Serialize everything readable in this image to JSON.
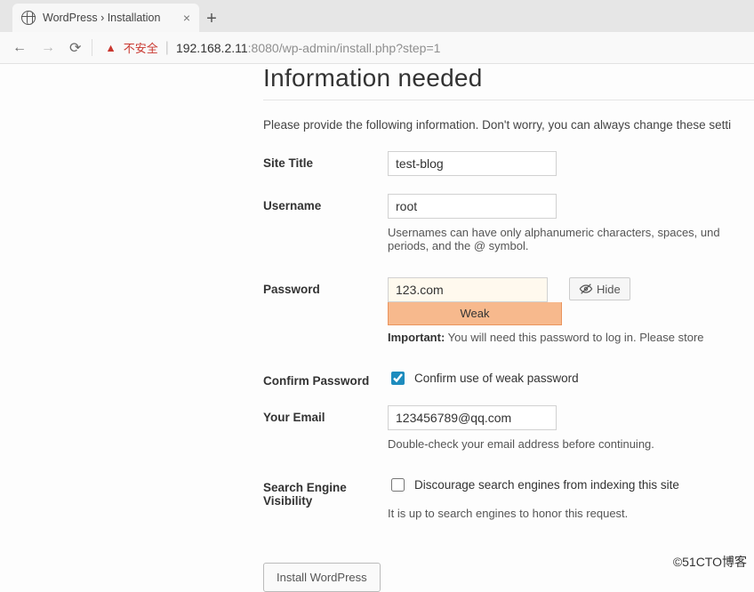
{
  "browser": {
    "tab_title": "WordPress › Installation",
    "not_secure_label": "不安全",
    "url_host": "192.168.2.11",
    "url_port_path": ":8080/wp-admin/install.php?step=1"
  },
  "page": {
    "heading": "Information needed",
    "intro": "Please provide the following information. Don't worry, you can always change these setti"
  },
  "form": {
    "site_title_label": "Site Title",
    "site_title_value": "test-blog",
    "username_label": "Username",
    "username_value": "root",
    "username_hint": "Usernames can have only alphanumeric characters, spaces, und\nperiods, and the @ symbol.",
    "password_label": "Password",
    "password_value": "123.com",
    "hide_button_label": "Hide",
    "password_strength": "Weak",
    "password_important_label": "Important:",
    "password_important_text": " You will need this password to log in. Please store",
    "confirm_password_label": "Confirm Password",
    "confirm_checkbox_label": "Confirm use of weak password",
    "email_label": "Your Email",
    "email_value": "123456789@qq.com",
    "email_hint": "Double-check your email address before continuing.",
    "sev_label_line1": "Search Engine",
    "sev_label_line2": "Visibility",
    "sev_checkbox_label": "Discourage search engines from indexing this site",
    "sev_hint": "It is up to search engines to honor this request.",
    "submit_label": "Install WordPress"
  },
  "watermark": "©51CTO博客"
}
